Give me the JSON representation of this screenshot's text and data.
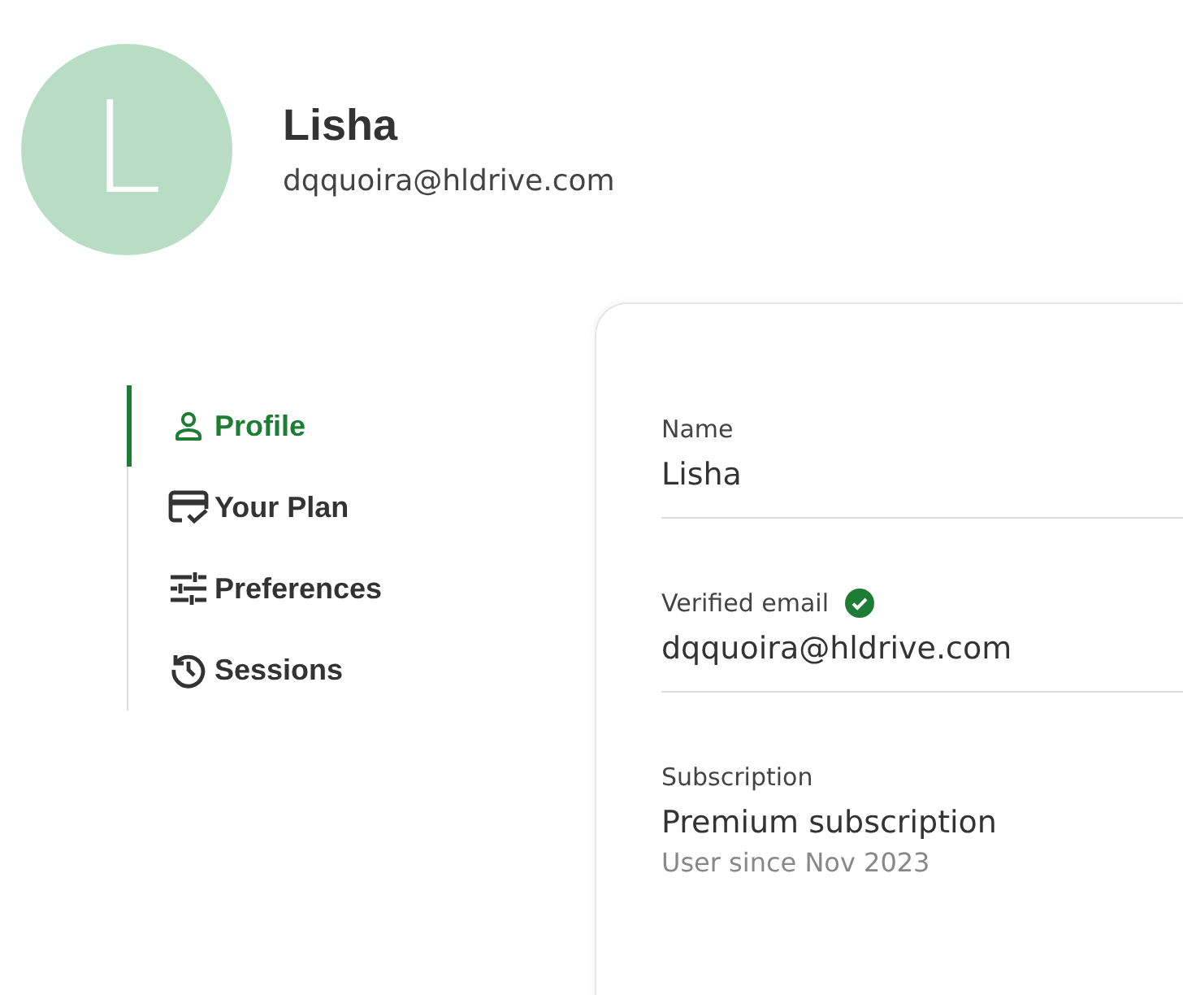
{
  "user": {
    "initial": "L",
    "name": "Lisha",
    "email": "dqquoira@hldrive.com"
  },
  "sidebar": {
    "items": [
      {
        "kind": "person",
        "label": "Profile",
        "selected": true
      },
      {
        "kind": "card",
        "label": "Your Plan",
        "selected": false
      },
      {
        "kind": "sliders",
        "label": "Preferences",
        "selected": false
      },
      {
        "kind": "history",
        "label": "Sessions",
        "selected": false
      }
    ]
  },
  "fields": [
    {
      "label": "Name",
      "value": "Lisha",
      "verified": false
    },
    {
      "label": "Verified email",
      "value": "dqquoira@hldrive.com",
      "verified": true
    },
    {
      "label": "Subscription",
      "value": "Premium subscription",
      "note": "User since Nov 2023",
      "verified": false
    }
  ]
}
